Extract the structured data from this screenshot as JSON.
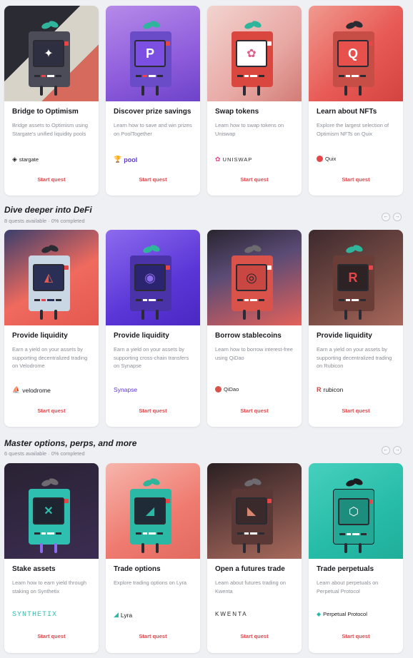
{
  "row1": [
    {
      "title": "Bridge to Optimism",
      "desc": "Bridge assets to Optimism using Stargate's unified liquidity pools",
      "partner": "stargate",
      "cta": "Start quest",
      "bg": "#2b2b33",
      "bg2": "#d7d3c9",
      "body": "#4b4c57",
      "screen": "#2e3041",
      "glyph": "✦"
    },
    {
      "title": "Discover prize savings",
      "desc": "Learn how to save and win prizes on PoolTogether",
      "partner": "pool",
      "cta": "Start quest",
      "bg": "#8e5cdc",
      "bg2": "#c59af3",
      "body": "#6a4cc9",
      "screen": "#7b4fe2",
      "glyph": "P"
    },
    {
      "title": "Swap tokens",
      "desc": "Learn how to swap tokens on Uniswap",
      "partner": "UNISWAP",
      "cta": "Start quest",
      "bg": "#e8a8a4",
      "bg2": "#f2d3cf",
      "body": "#d9473f",
      "screen": "#ffffff",
      "glyph": "🦄"
    },
    {
      "title": "Learn about NFTs",
      "desc": "Explore the largest selection of Optimism NFTs on Quix",
      "partner": "Quix",
      "cta": "Start quest",
      "bg": "#e85a55",
      "bg2": "#f09a8f",
      "body": "#c74d47",
      "screen": "#e8504b",
      "glyph": "Q"
    }
  ],
  "section2": {
    "title": "Dive deeper into DeFi",
    "sub": "8 quests available · 0% completed",
    "prev": "←",
    "next": "→"
  },
  "row2": [
    {
      "title": "Provide liquidity",
      "desc": "Earn a yield on your assets by supporting decentralized trading on Velodrome",
      "partner": "velodrome",
      "cta": "Start quest",
      "bg": "#f06a5e",
      "bg2": "#3a3f6c",
      "body": "#c9d6e4",
      "screen": "#2a2f55",
      "glyph": "⛵"
    },
    {
      "title": "Provide liquidity",
      "desc": "Earn a yield on your assets by supporting cross-chain transfers on Synapse",
      "partner": "Synapse",
      "cta": "Start quest",
      "bg": "#5b36d7",
      "bg2": "#8c6bee",
      "body": "#4a33a8",
      "screen": "#2b2470",
      "glyph": "◉"
    },
    {
      "title": "Borrow stablecoins",
      "desc": "Learn how to borrow interest-free using QiDao",
      "partner": "QiDao",
      "cta": "Start quest",
      "bg": "#2a2530",
      "bg2": "#e4615a",
      "body": "#d9534b",
      "screen": "#c94742",
      "glyph": "◎"
    },
    {
      "title": "Provide liquidity",
      "desc": "Earn a yield on your assets by supporting decentralized trading on Rubicon",
      "partner": "rubicon",
      "cta": "Start quest",
      "bg": "#3d2a2e",
      "bg2": "#7a4d45",
      "body": "#6a3d37",
      "screen": "#2d2324",
      "glyph": "R"
    }
  ],
  "section3": {
    "title": "Master options, perps, and more",
    "sub": "6 quests available · 0% completed",
    "prev": "←",
    "next": "→"
  },
  "row3": [
    {
      "title": "Stake assets",
      "desc": "Learn how to earn yield through staking on Synthetix",
      "partner": "SYNTHETIX",
      "cta": "Start quest",
      "bg": "#2a2233",
      "bg2": "#3b2d52",
      "body": "#2fbfb0",
      "screen": "#1e2430",
      "glyph": "✕"
    },
    {
      "title": "Trade options",
      "desc": "Explore trading options on Lyra",
      "partner": "Lyra",
      "cta": "Start quest",
      "bg": "#ef7a6f",
      "bg2": "#f6b5ac",
      "body": "#2bb9a6",
      "screen": "#1f2b36",
      "glyph": "◢"
    },
    {
      "title": "Open a futures trade",
      "desc": "Learn about futures trading on Kwenta",
      "partner": "KWENTA",
      "cta": "Start quest",
      "bg": "#2b2022",
      "bg2": "#a86a5c",
      "body": "#5a3836",
      "screen": "#3a2a2b",
      "glyph": "◣"
    },
    {
      "title": "Trade perpetuals",
      "desc": "Learn about perpetuals on Perpetual Protocol",
      "partner": "Perpetual Protocol",
      "cta": "Start quest",
      "bg": "#27bca8",
      "bg2": "#46d0bd",
      "body": "#23a895",
      "screen": "#1d8d7d",
      "glyph": "⬡"
    }
  ]
}
